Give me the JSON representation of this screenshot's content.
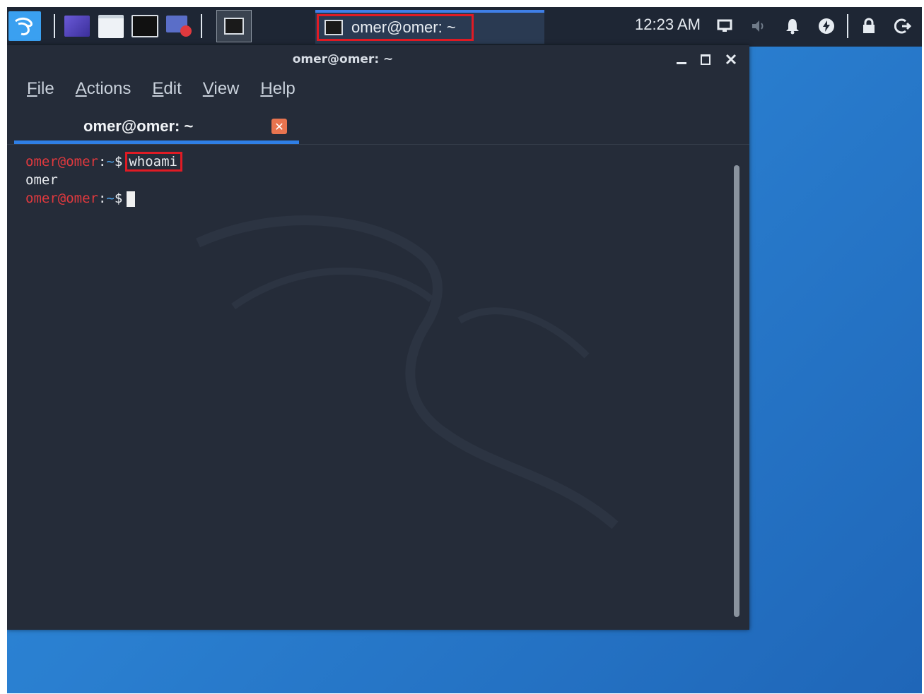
{
  "panel": {
    "launchers": [
      {
        "name": "kali-menu-icon"
      },
      {
        "name": "show-desktop-icon"
      },
      {
        "name": "file-manager-icon"
      },
      {
        "name": "terminal-launcher-icon"
      },
      {
        "name": "screenshot-icon"
      }
    ],
    "active_task_icon": "terminal-icon",
    "taskbar_window_title": "omer@omer: ~",
    "clock": "12:23 AM",
    "tray": [
      "display-icon",
      "volume-icon",
      "bell-icon",
      "power-icon",
      "lock-icon",
      "logout-icon"
    ]
  },
  "window": {
    "title": "omer@omer: ~",
    "menu": [
      "File",
      "Actions",
      "Edit",
      "View",
      "Help"
    ],
    "tab_label": "omer@omer: ~",
    "tab_close_glyph": "✕"
  },
  "terminal": {
    "prompt_user": "omer@omer",
    "prompt_sep": ":",
    "prompt_path": "~",
    "prompt_symbol": "$",
    "command": "whoami",
    "output": "omer"
  },
  "colors": {
    "accent": "#2f7fe6",
    "highlight": "#e01b24",
    "prompt_user": "#e0393e",
    "prompt_path": "#4ea3e8"
  }
}
